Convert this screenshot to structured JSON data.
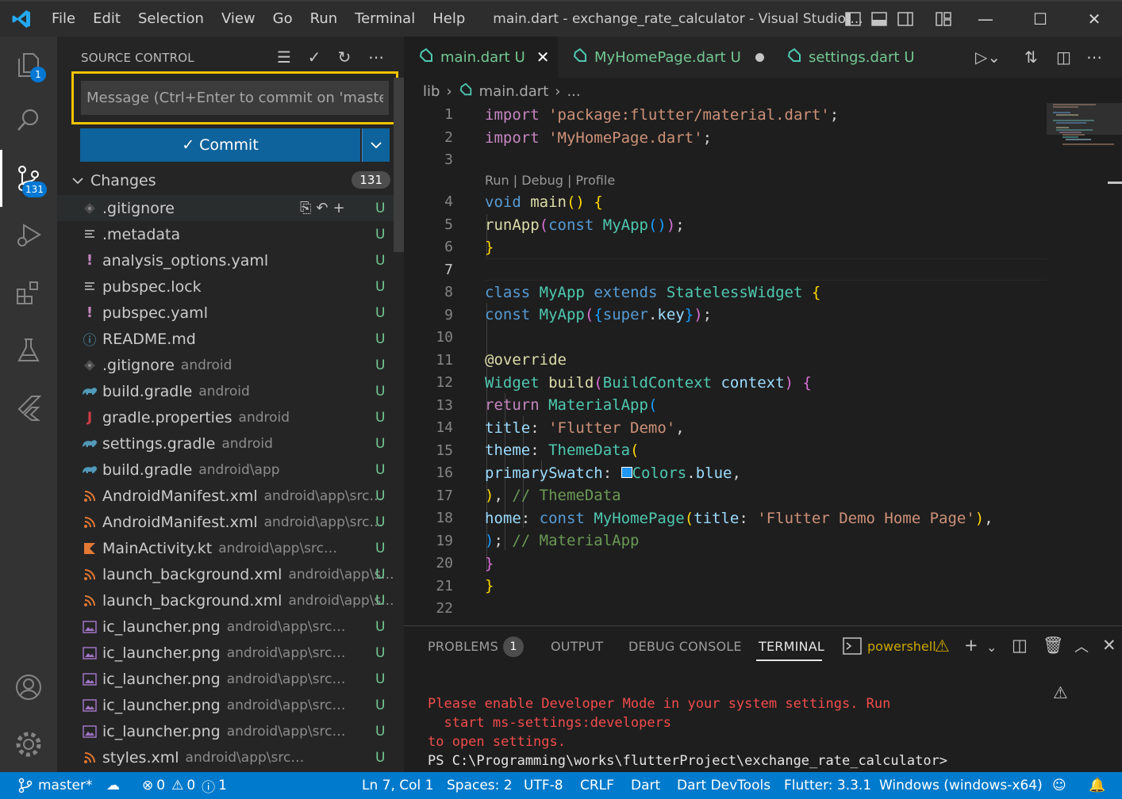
{
  "colors": {
    "accent": "#007acc",
    "highlight_outline": "#f5c400",
    "untracked": "#73c991",
    "error": "#f14c4c"
  },
  "titlebar": {
    "menu": [
      "File",
      "Edit",
      "Selection",
      "View",
      "Go",
      "Run",
      "Terminal",
      "Help"
    ],
    "title": "main.dart - exchange_rate_calculator - Visual Studio ..."
  },
  "activity": {
    "explorer_badge": "1",
    "scm_badge": "131"
  },
  "scm": {
    "title": "SOURCE CONTROL",
    "message_placeholder": "Message (Ctrl+Enter to commit on 'master')",
    "commit_label": "✓ Commit",
    "changes_label": "Changes",
    "changes_count": "131",
    "files": [
      {
        "name": ".gitignore",
        "path": "",
        "status": "U",
        "icon": "git-icon"
      },
      {
        "name": ".metadata",
        "path": "",
        "status": "U",
        "icon": "lines-icon"
      },
      {
        "name": "analysis_options.yaml",
        "path": "",
        "status": "U",
        "icon": "yaml-icon"
      },
      {
        "name": "pubspec.lock",
        "path": "",
        "status": "U",
        "icon": "lines-icon"
      },
      {
        "name": "pubspec.yaml",
        "path": "",
        "status": "U",
        "icon": "yaml-icon"
      },
      {
        "name": "README.md",
        "path": "",
        "status": "U",
        "icon": "info-icon"
      },
      {
        "name": ".gitignore",
        "path": "android",
        "status": "U",
        "icon": "git-icon"
      },
      {
        "name": "build.gradle",
        "path": "android",
        "status": "U",
        "icon": "gradle-icon"
      },
      {
        "name": "gradle.properties",
        "path": "android",
        "status": "U",
        "icon": "java-icon"
      },
      {
        "name": "settings.gradle",
        "path": "android",
        "status": "U",
        "icon": "gradle-icon"
      },
      {
        "name": "build.gradle",
        "path": "android\\app",
        "status": "U",
        "icon": "gradle-icon"
      },
      {
        "name": "AndroidManifest.xml",
        "path": "android\\app\\src\\...",
        "status": "U",
        "icon": "rss-icon"
      },
      {
        "name": "AndroidManifest.xml",
        "path": "android\\app\\src\\...",
        "status": "U",
        "icon": "rss-icon"
      },
      {
        "name": "MainActivity.kt",
        "path": "android\\app\\src\\main\\k...",
        "status": "U",
        "icon": "kotlin-icon"
      },
      {
        "name": "launch_background.xml",
        "path": "android\\app\\s...",
        "status": "U",
        "icon": "rss-icon"
      },
      {
        "name": "launch_background.xml",
        "path": "android\\app\\s...",
        "status": "U",
        "icon": "rss-icon"
      },
      {
        "name": "ic_launcher.png",
        "path": "android\\app\\src\\main\\...",
        "status": "U",
        "icon": "image-icon"
      },
      {
        "name": "ic_launcher.png",
        "path": "android\\app\\src\\main\\...",
        "status": "U",
        "icon": "image-icon"
      },
      {
        "name": "ic_launcher.png",
        "path": "android\\app\\src\\main\\...",
        "status": "U",
        "icon": "image-icon"
      },
      {
        "name": "ic_launcher.png",
        "path": "android\\app\\src\\main\\...",
        "status": "U",
        "icon": "image-icon"
      },
      {
        "name": "ic_launcher.png",
        "path": "android\\app\\src\\main\\...",
        "status": "U",
        "icon": "image-icon"
      },
      {
        "name": "styles.xml",
        "path": "android\\app\\src\\main\\res\\val...",
        "status": "U",
        "icon": "rss-icon"
      }
    ]
  },
  "tabs": [
    {
      "label": "main.dart",
      "status": "U"
    },
    {
      "label": "MyHomePage.dart",
      "status": "U"
    },
    {
      "label": "settings.dart",
      "status": "U"
    }
  ],
  "breadcrumb": {
    "folder": "lib",
    "file": "main.dart",
    "rest": "..."
  },
  "editor": {
    "codelens": "Run | Debug | Profile",
    "line_numbers": [
      "1",
      "2",
      "3",
      "4",
      "5",
      "6",
      "7",
      "8",
      "9",
      "10",
      "11",
      "12",
      "13",
      "14",
      "15",
      "16",
      "17",
      "18",
      "19",
      "20",
      "21",
      "22"
    ],
    "current_line": 7
  },
  "panel": {
    "tabs": [
      "PROBLEMS",
      "OUTPUT",
      "DEBUG CONSOLE",
      "TERMINAL"
    ],
    "problems_count": "1",
    "terminal_name": "powershell",
    "output": [
      "Please enable Developer Mode in your system settings. Run",
      "  start ms-settings:developers",
      "to open settings.",
      "PS C:\\Programming\\works\\flutterProject\\exchange_rate_calculator>"
    ]
  },
  "statusbar": {
    "branch": "master*",
    "errors": "0",
    "warnings": "0",
    "infos": "1",
    "position": "Ln 7, Col 1",
    "spaces": "Spaces: 2",
    "encoding": "UTF-8",
    "eol": "CRLF",
    "language": "Dart",
    "devtools": "Dart DevTools",
    "flutter": "Flutter: 3.3.1",
    "device": "Windows (windows-x64)"
  }
}
